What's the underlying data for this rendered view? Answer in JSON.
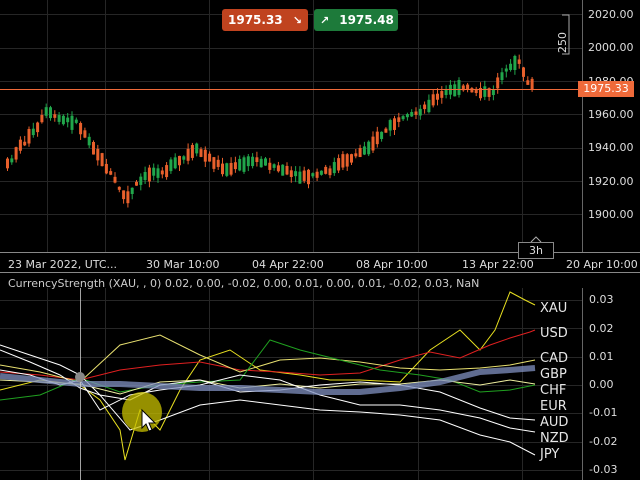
{
  "toolbar": {
    "sell_price": "1975.33",
    "buy_price": "1975.48",
    "sell_arrow": "↘",
    "buy_arrow": "↗"
  },
  "price_chart": {
    "current_price_tag": "1975.33",
    "zoom_label": "250",
    "period_label": "3h",
    "y_labels": [
      "2020.00",
      "2000.00",
      "1980.00",
      "1960.00",
      "1940.00",
      "1920.00",
      "1900.00"
    ],
    "x_labels": [
      "23 Mar 2022, UTC...",
      "30 Mar 10:00",
      "04 Apr 22:00",
      "08 Apr 10:00",
      "13 Apr 22:00",
      "20 Apr 10:00"
    ],
    "colors": {
      "up": "#21a64b",
      "down": "#e8602c",
      "price_line": "#ef6a3a",
      "grid": "#262626"
    }
  },
  "indicator": {
    "title": "CurrencyStrength (XAU, , 0) 0.02, 0.00, -0.02, 0.00, 0.01, 0.00, 0.01, -0.02, 0.03, NaN",
    "y_labels": [
      "0.03",
      "0.02",
      "0.01",
      "0.00",
      "-0.01",
      "-0.02",
      "-0.03"
    ],
    "currencies": [
      "XAU",
      "USD",
      "CAD",
      "GBP",
      "CHF",
      "EUR",
      "AUD",
      "NZD",
      "JPY"
    ],
    "colors": {
      "XAU": "#e8e020",
      "USD": "#e02020",
      "CAD": "#e8e070",
      "GBP": "#8090c0",
      "CHF": "#f0f0a0",
      "EUR": "#20a020",
      "AUD": "#ffffff",
      "NZD": "#ffffff",
      "JPY": "#ffffff"
    }
  },
  "cursor": {
    "icon": "mouse-pointer-icon",
    "highlight_color": "#c8c000"
  }
}
